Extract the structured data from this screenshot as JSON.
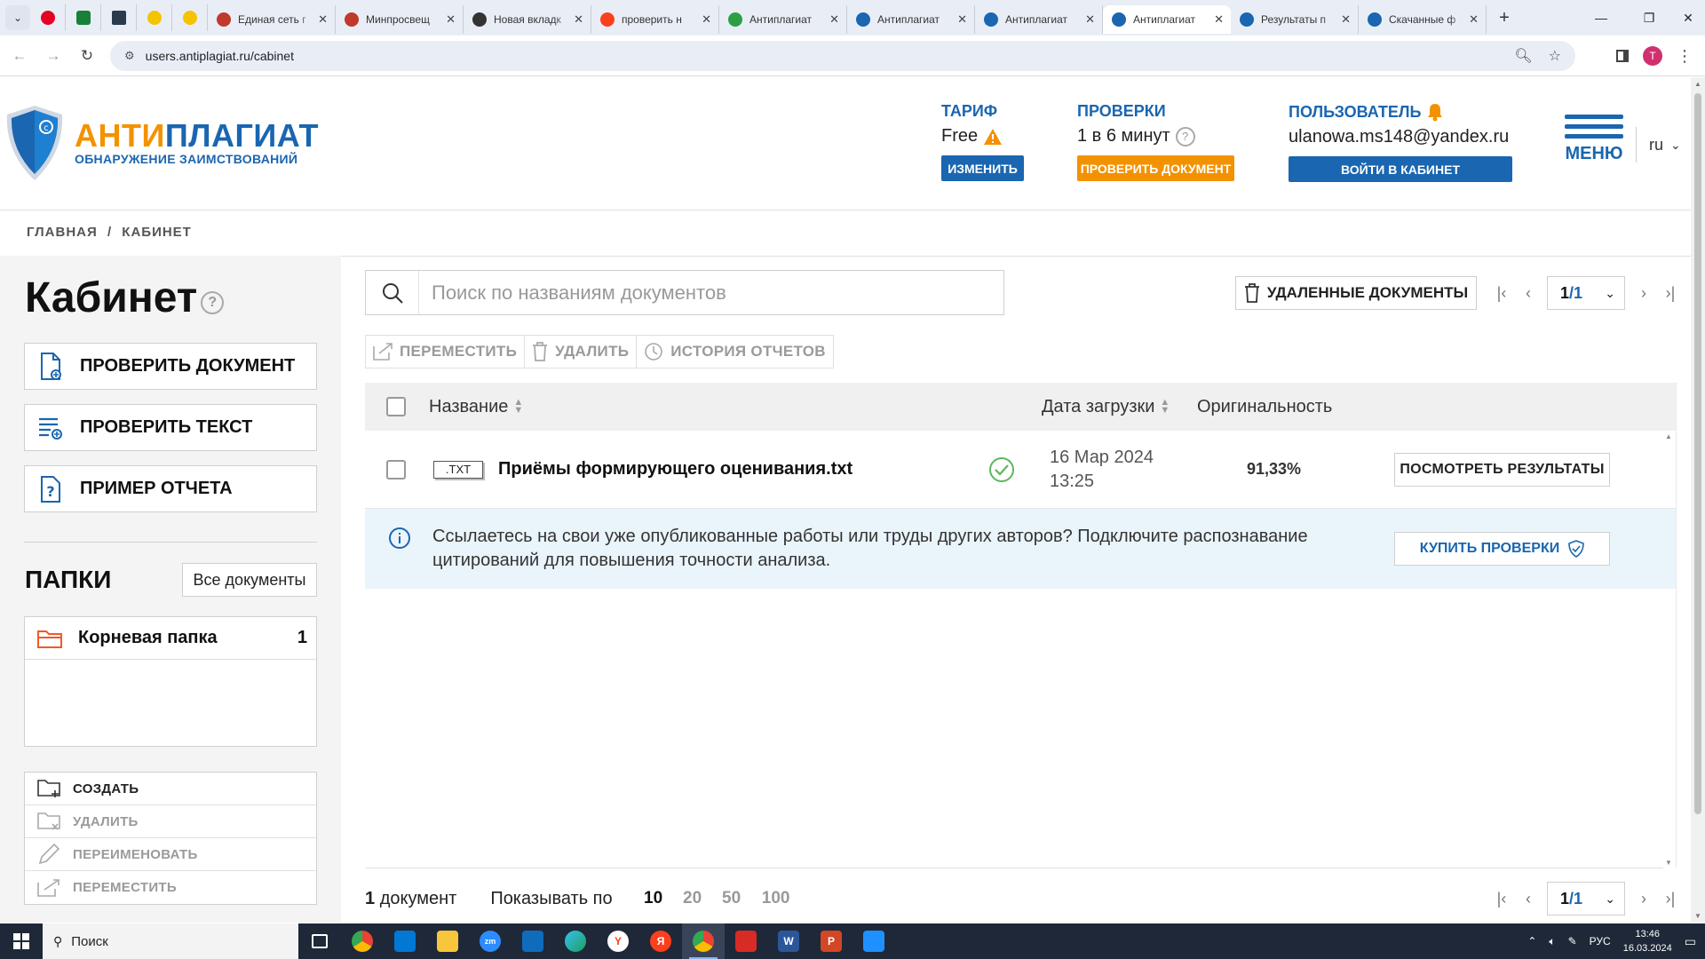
{
  "browser": {
    "tabs": [
      {
        "title": "Единая сеть г",
        "color": "#c0392b"
      },
      {
        "title": "Минпросвещ",
        "color": "#c0392b"
      },
      {
        "title": "Новая вкладк",
        "color": "#333333"
      },
      {
        "title": "проверить н",
        "color": "#fc3f1d"
      },
      {
        "title": "Антиплагиат",
        "color": "#2e9e44"
      },
      {
        "title": "Антиплагиат",
        "color": "#1a66b0"
      },
      {
        "title": "Антиплагиат",
        "color": "#1a66b0"
      },
      {
        "title": "Антиплагиат",
        "color": "#1a66b0",
        "active": true
      },
      {
        "title": "Результаты п",
        "color": "#1a66b0"
      },
      {
        "title": "Скачанные ф",
        "color": "#1a66b0"
      }
    ],
    "url": "users.antiplagiat.ru/cabinet",
    "avatar_letter": "T"
  },
  "header": {
    "logo_part1": "АНТИ",
    "logo_part2": "ПЛАГИАТ",
    "logo_sub": "ОБНАРУЖЕНИЕ ЗАИМСТВОВАНИЙ",
    "tariff_label": "ТАРИФ",
    "tariff_value": "Free",
    "tariff_btn": "ИЗМЕНИТЬ",
    "checks_label": "ПРОВЕРКИ",
    "checks_value": "1 в 6 минут",
    "checks_btn": "ПРОВЕРИТЬ ДОКУМЕНТ",
    "user_label": "ПОЛЬЗОВАТЕЛЬ",
    "user_email": "ulanowa.ms148@yandex.ru",
    "user_btn": "ВОЙТИ В КАБИНЕТ",
    "menu_label": "МЕНЮ",
    "lang": "ru"
  },
  "breadcrumb": {
    "home": "ГЛАВНАЯ",
    "sep": "/",
    "current": "КАБИНЕТ"
  },
  "sidebar": {
    "title": "Кабинет",
    "buttons": [
      "ПРОВЕРИТЬ ДОКУМЕНТ",
      "ПРОВЕРИТЬ ТЕКСТ",
      "ПРИМЕР ОТЧЕТА"
    ],
    "folders_title": "ПАПКИ",
    "all_docs": "Все документы",
    "folders": [
      {
        "name": "Корневая папка",
        "count": "1"
      }
    ],
    "folder_actions": [
      {
        "label": "СОЗДАТЬ",
        "enabled": true
      },
      {
        "label": "УДАЛИТЬ",
        "enabled": false
      },
      {
        "label": "ПЕРЕИМЕНОВАТЬ",
        "enabled": false
      },
      {
        "label": "ПЕРЕМЕСТИТЬ",
        "enabled": false
      }
    ]
  },
  "main": {
    "search_placeholder": "Поиск по названиям документов",
    "deleted_docs": "УДАЛЕННЫЕ ДОКУМЕНТЫ",
    "page_current": "1",
    "page_total": "/1",
    "actions": [
      "ПЕРЕМЕСТИТЬ",
      "УДАЛИТЬ",
      "ИСТОРИЯ ОТЧЕТОВ"
    ],
    "columns": {
      "name": "Название",
      "date": "Дата загрузки",
      "originality": "Оригинальность"
    },
    "rows": [
      {
        "ext": ".TXT",
        "name": "Приёмы формирующего оценивания.txt",
        "date": "16 Мар 2024",
        "time": "13:25",
        "originality": "91,33%",
        "action": "ПОСМОТРЕТЬ РЕЗУЛЬТАТЫ"
      }
    ],
    "info_text": "Ссылаетесь на свои уже опубликованные работы или труды других авторов? Подключите распознавание цитирований для повышения точности анализа.",
    "buy_btn": "КУПИТЬ ПРОВЕРКИ",
    "footer_count": "1",
    "footer_count_word": "документ",
    "show_per": "Показывать по",
    "page_sizes": [
      "10",
      "20",
      "50",
      "100"
    ]
  },
  "taskbar": {
    "search": "Поиск",
    "lang": "РУС",
    "time": "13:46",
    "date": "16.03.2024"
  }
}
